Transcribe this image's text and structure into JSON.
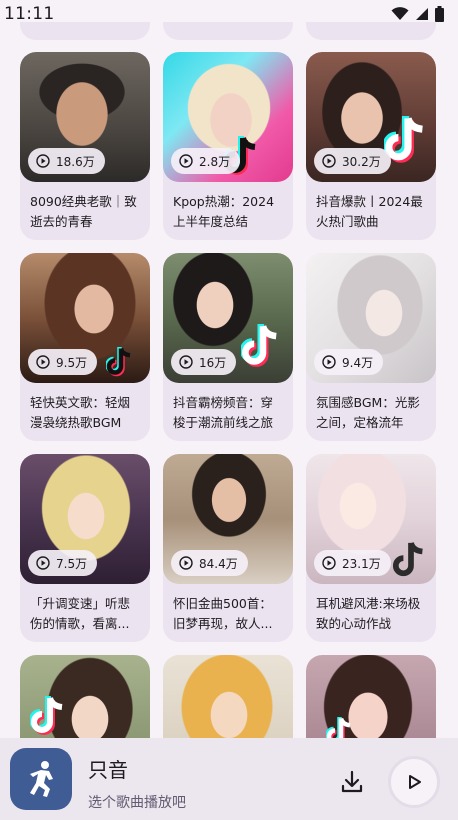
{
  "status_bar": {
    "time": "11:11"
  },
  "cards": [
    {
      "plays": "18.6万",
      "title": "8090经典老歌｜致逝去的青春"
    },
    {
      "plays": "2.8万",
      "title": "Kpop热潮：2024上半年度总结"
    },
    {
      "plays": "30.2万",
      "title": "抖音爆款丨2024最火热门歌曲"
    },
    {
      "plays": "9.5万",
      "title": "轻快英文歌：轻烟漫袅绕热歌BGM"
    },
    {
      "plays": "16万",
      "title": "抖音霸榜频音：穿梭于潮流前线之旅"
    },
    {
      "plays": "9.4万",
      "title": "氛围感BGM：光影之间，定格流年"
    },
    {
      "plays": "7.5万",
      "title": "「升调变速」听悲伤的情歌，看离..."
    },
    {
      "plays": "84.4万",
      "title": "怀旧金曲500首：旧梦再现，故人..."
    },
    {
      "plays": "23.1万",
      "title": "耳机避风港:来场极致的心动作战"
    }
  ],
  "player": {
    "title": "只音",
    "subtitle": "选个歌曲播放吧"
  }
}
